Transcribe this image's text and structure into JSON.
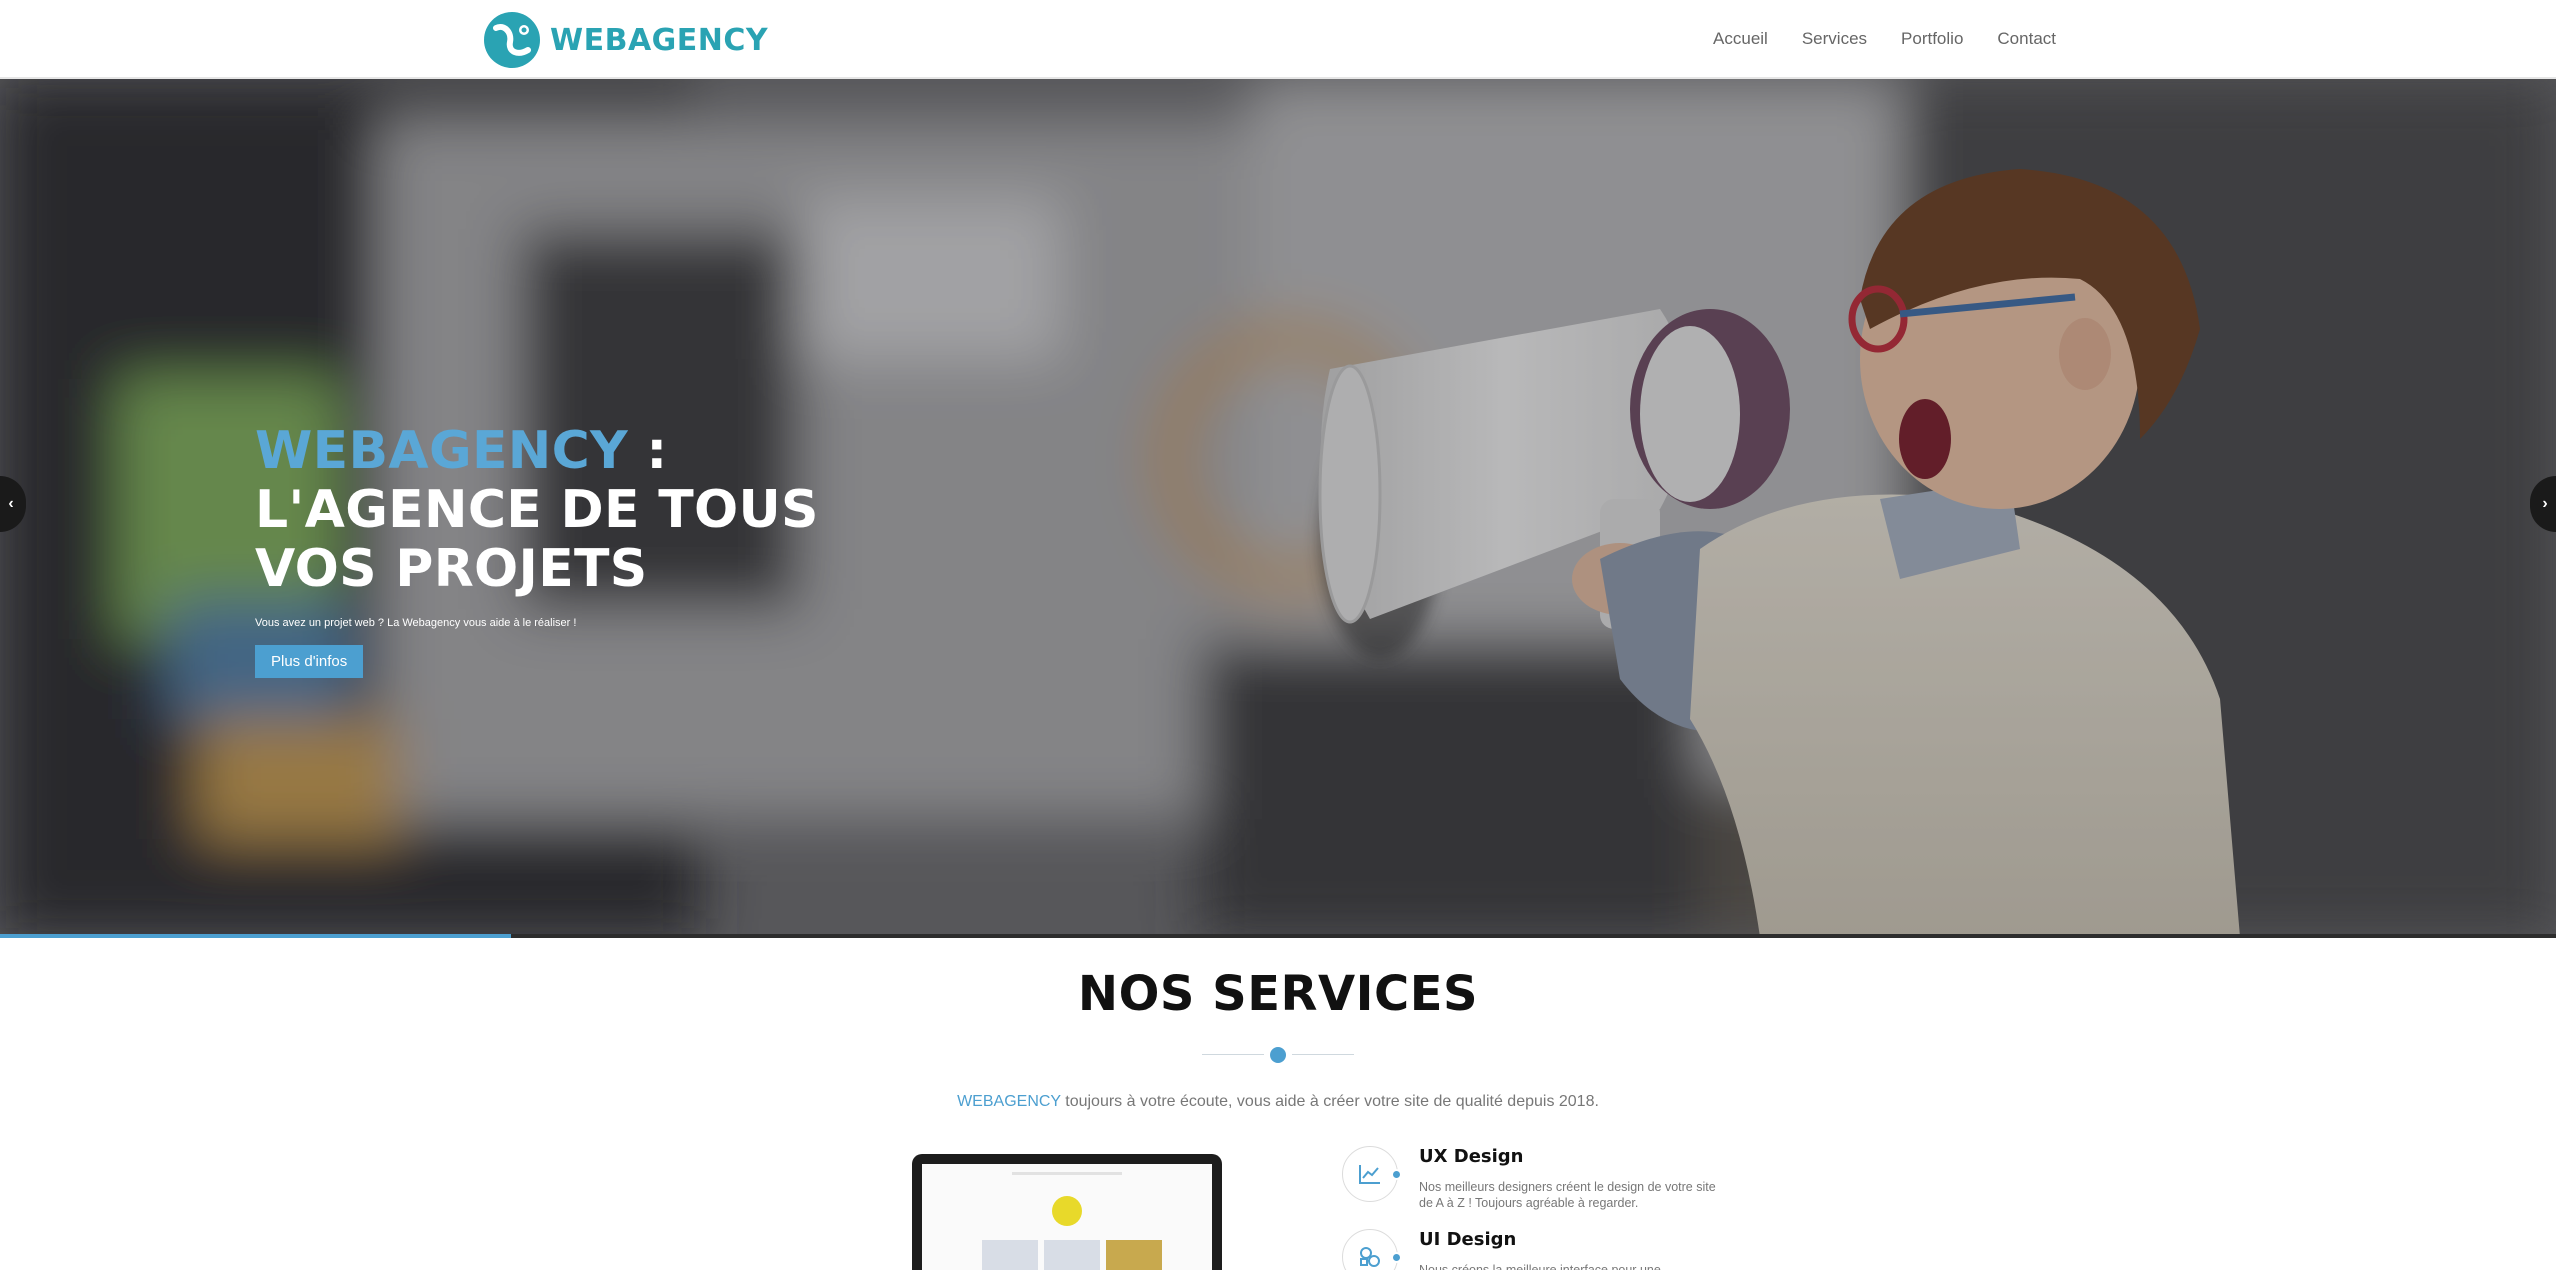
{
  "header": {
    "logo_text": "WEBAGENCY",
    "nav": [
      "Accueil",
      "Services",
      "Portfolio",
      "Contact"
    ]
  },
  "hero": {
    "title_brand": "WEBAGENCY",
    "title_rest": " : L'AGENCE DE TOUS VOS PROJETS",
    "subtitle": "Vous avez un projet web ? La Webagency vous aide à le réaliser !",
    "button_label": "Plus d'infos",
    "slide_progress": 0.2,
    "prev_icon": "chevron-left-icon",
    "next_icon": "chevron-right-icon"
  },
  "services": {
    "title": "NOS SERVICES",
    "intro_brand": "WEBAGENCY",
    "intro_rest": " toujours à votre écoute, vous aide à créer votre site de qualité depuis 2018.",
    "items": [
      {
        "title": "UX Design",
        "desc": "Nos meilleurs designers créent le design de votre site de A à Z ! Toujours agréable à regarder.",
        "icon": "chart-line-icon"
      },
      {
        "title": "UI Design",
        "desc": "Nous créons la meilleure interface pour une",
        "icon": "shapes-icon"
      }
    ]
  },
  "colors": {
    "accent": "#4c9fd0",
    "logo": "#2aa3b3",
    "text_muted": "#777777"
  }
}
